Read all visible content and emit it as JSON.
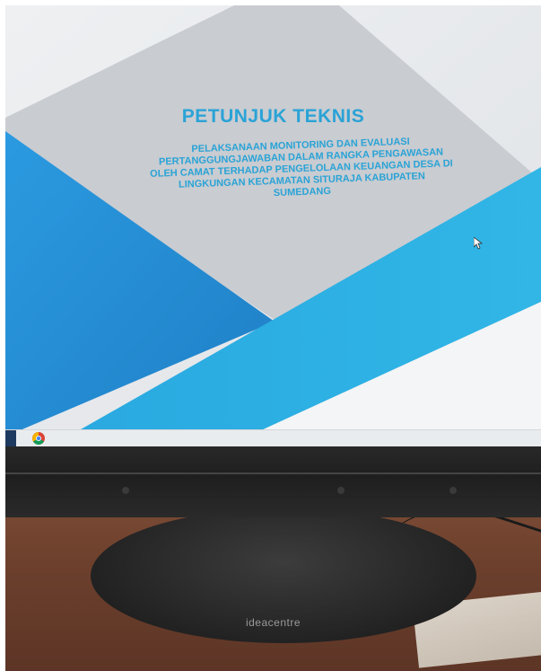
{
  "slide": {
    "title": "PETUNJUK TEKNIS",
    "subtitle_lines": [
      "PELAKSANAAN MONITORING DAN EVALUASI",
      "PERTANGGUNGJAWABAN DALAM RANGKA PENGAWASAN",
      "OLEH CAMAT TERHADAP PENGELOLAAN KEUANGAN DESA DI",
      "LINGKUNGAN KECAMATAN SITURAJA KABUPATEN",
      "SUMEDANG"
    ]
  },
  "monitor": {
    "brand": "ideacentre"
  },
  "taskbar": {
    "apps": [
      "chrome-icon"
    ]
  },
  "colors": {
    "title_blue": "#2aa3d6",
    "slide_blue": "#27a8df",
    "slide_dark_blue": "#1f86c8",
    "slide_gray": "#c9ccd1"
  }
}
